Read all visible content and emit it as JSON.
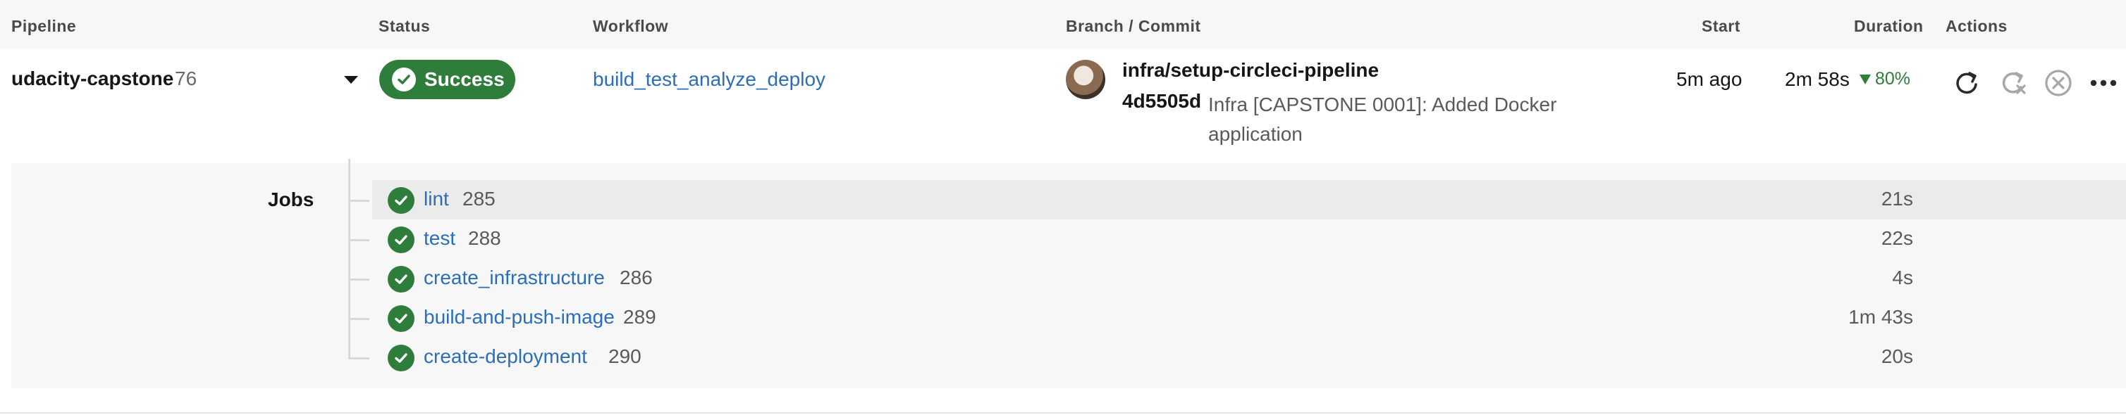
{
  "header": {
    "pipeline": "Pipeline",
    "status": "Status",
    "workflow": "Workflow",
    "branch_commit": "Branch / Commit",
    "start": "Start",
    "duration": "Duration",
    "actions": "Actions"
  },
  "pipeline": {
    "name": "udacity-capstone",
    "number": "76",
    "status": "Success",
    "workflow": "build_test_analyze_deploy",
    "branch": "infra/setup-circleci-pipeline",
    "commit_sha": "4d5505d",
    "commit_message": "Infra [CAPSTONE 0001]: Added Docker application",
    "start": "5m ago",
    "duration": "2m 58s",
    "improvement": "80%",
    "status_color": "#2f7d3a",
    "link_color": "#2a6ebb"
  },
  "actions": [
    "rerun-icon",
    "rerun-failed-icon",
    "cancel-icon",
    "more-icon"
  ],
  "jobs": {
    "label": "Jobs",
    "items": [
      {
        "name": "lint",
        "number": "285",
        "duration": "21s"
      },
      {
        "name": "test",
        "number": "288",
        "duration": "22s"
      },
      {
        "name": "create_infrastructure",
        "number": "286",
        "duration": "4s"
      },
      {
        "name": "build-and-push-image",
        "number": "289",
        "duration": "1m 43s"
      },
      {
        "name": "create-deployment",
        "number": "290",
        "duration": "20s"
      }
    ]
  }
}
